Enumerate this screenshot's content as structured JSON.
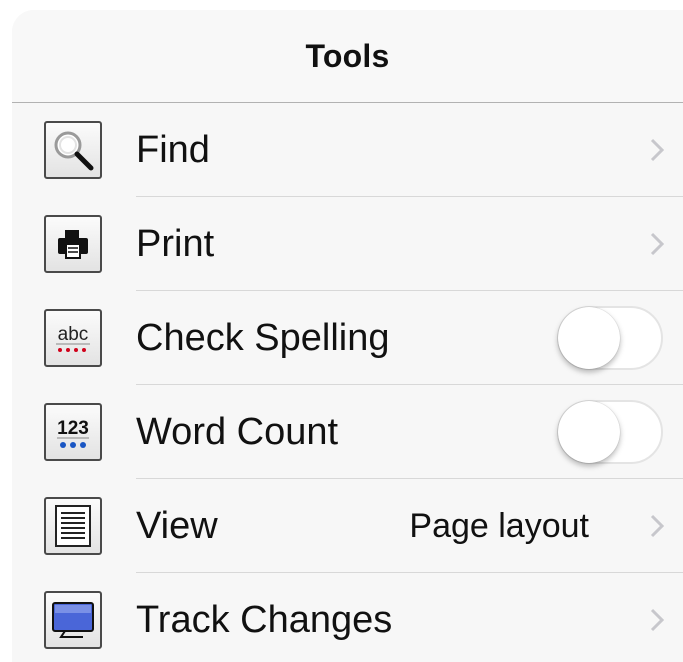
{
  "header": {
    "title": "Tools"
  },
  "items": [
    {
      "label": "Find",
      "icon": "magnifier-icon",
      "accessory": "chevron"
    },
    {
      "label": "Print",
      "icon": "printer-icon",
      "accessory": "chevron"
    },
    {
      "label": "Check Spelling",
      "icon": "spelling-icon",
      "icon_text": "abc",
      "accessory": "toggle",
      "toggle_on": false
    },
    {
      "label": "Word Count",
      "icon": "word-count-icon",
      "icon_text": "123",
      "accessory": "toggle",
      "toggle_on": false
    },
    {
      "label": "View",
      "icon": "page-layout-icon",
      "value": "Page layout",
      "accessory": "chevron"
    },
    {
      "label": "Track Changes",
      "icon": "track-changes-icon",
      "accessory": "chevron"
    }
  ],
  "colors": {
    "chevron": "#c7c7cc",
    "spelling_dots": "#d0021b",
    "count_dots": "#1a56c4",
    "screen_blue": "#4a66d8"
  }
}
